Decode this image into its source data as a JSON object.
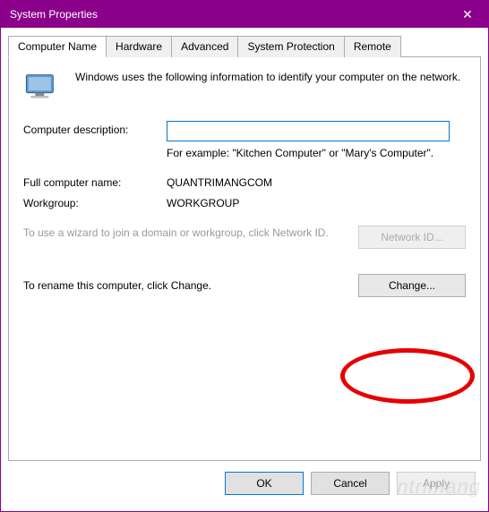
{
  "window": {
    "title": "System Properties",
    "close_label": "✕"
  },
  "tabs": [
    {
      "label": "Computer Name"
    },
    {
      "label": "Hardware"
    },
    {
      "label": "Advanced"
    },
    {
      "label": "System Protection"
    },
    {
      "label": "Remote"
    }
  ],
  "panel": {
    "intro": "Windows uses the following information to identify your computer on the network.",
    "desc_label": "Computer description:",
    "desc_value": "",
    "desc_example": "For example: \"Kitchen Computer\" or \"Mary's Computer\".",
    "fullname_label": "Full computer name:",
    "fullname_value": "QUANTRIMANGCOM",
    "workgroup_label": "Workgroup:",
    "workgroup_value": "WORKGROUP",
    "wizard_text": "To use a wizard to join a domain or workgroup, click Network ID.",
    "network_id_button": "Network ID...",
    "rename_text": "To rename this computer, click Change.",
    "change_button": "Change..."
  },
  "buttons": {
    "ok": "OK",
    "cancel": "Cancel",
    "apply": "Apply"
  },
  "watermark": "ntrimang"
}
